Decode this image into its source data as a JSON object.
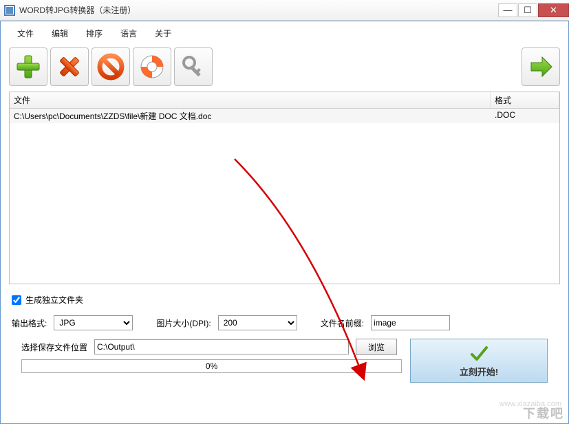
{
  "window": {
    "title": "WORD转JPG转换器（未注册）"
  },
  "menu": {
    "file": "文件",
    "edit": "编辑",
    "sort": "排序",
    "language": "语言",
    "about": "关于"
  },
  "list": {
    "header_file": "文件",
    "header_format": "格式",
    "rows": [
      {
        "file": "C:\\Users\\pc\\Documents\\ZZDS\\file\\新建 DOC 文档.doc",
        "format": ".DOC"
      }
    ]
  },
  "options": {
    "create_subfolder_label": "生成独立文件夹",
    "create_subfolder_checked": true,
    "output_format_label": "输出格式:",
    "output_format_value": "JPG",
    "dpi_label": "图片大小(DPI):",
    "dpi_value": "200",
    "prefix_label": "文件名前缀:",
    "prefix_value": "image",
    "output_path_label": "选择保存文件位置",
    "output_path_value": "C:\\Output\\",
    "browse_label": "浏览"
  },
  "progress": {
    "text": "0%"
  },
  "start": {
    "label": "立刻开始!"
  },
  "watermark": {
    "big": "下载吧",
    "small": "www.xiazaiba.com"
  }
}
